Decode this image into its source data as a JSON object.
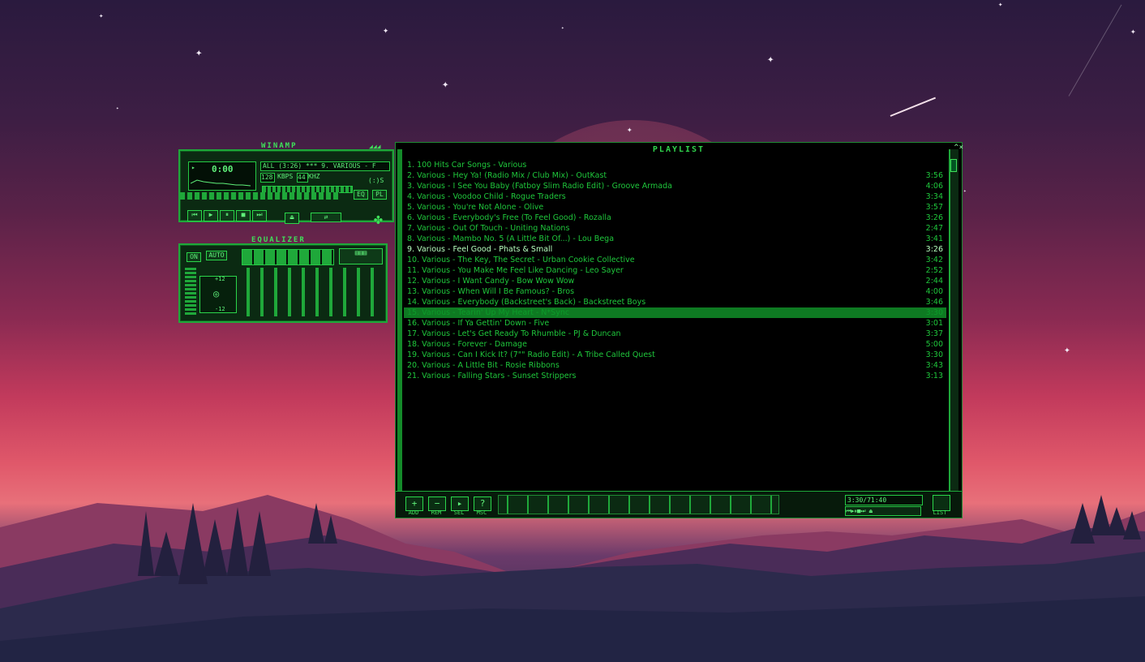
{
  "main_window": {
    "title": "WINAMP",
    "song_ticker": "ALL (3:26) *** 9. VARIOUS - F",
    "time": "0:00",
    "bitrate": "128",
    "kbps_label": "KBPS",
    "khz": "44",
    "khz_label": "KHZ",
    "stereo_label": "(:)S",
    "eq_label": "EQ",
    "pl_label": "PL"
  },
  "equalizer": {
    "title": "EQUALIZER",
    "on_label": "ON",
    "auto_label": "AUTO",
    "plus_label": "+12",
    "minus_label": "-12"
  },
  "playlist": {
    "title": "PLAYLIST",
    "buttons": [
      {
        "icon": "+",
        "label": "ADD"
      },
      {
        "icon": "−",
        "label": "REM"
      },
      {
        "icon": "▸",
        "label": "SEL"
      },
      {
        "icon": "?",
        "label": "MSC"
      }
    ],
    "list_label": "LIST",
    "time_display": "3:30/71:40",
    "tracks": [
      {
        "num": "1.",
        "title": "100 Hits Car Songs - Various",
        "duration": ""
      },
      {
        "num": "2.",
        "title": "Various - Hey Ya! (Radio Mix / Club Mix) - OutKast",
        "duration": "3:56"
      },
      {
        "num": "3.",
        "title": "Various - I See You Baby (Fatboy Slim Radio Edit) - Groove Armada",
        "duration": "4:06"
      },
      {
        "num": "4.",
        "title": "Various - Voodoo Child - Rogue Traders",
        "duration": "3:34"
      },
      {
        "num": "5.",
        "title": "Various - You're Not Alone - Olive",
        "duration": "3:57"
      },
      {
        "num": "6.",
        "title": "Various - Everybody's Free (To Feel Good) - Rozalla",
        "duration": "3:26"
      },
      {
        "num": "7.",
        "title": "Various - Out Of Touch - Uniting Nations",
        "duration": "2:47"
      },
      {
        "num": "8.",
        "title": "Various - Mambo No. 5 (A Little Bit Of...) - Lou Bega",
        "duration": "3:41"
      },
      {
        "num": "9.",
        "title": "Various - Feel Good - Phats & Small",
        "duration": "3:26"
      },
      {
        "num": "10.",
        "title": "Various - The Key, The Secret - Urban Cookie Collective",
        "duration": "3:42"
      },
      {
        "num": "11.",
        "title": "Various - You Make Me Feel Like Dancing - Leo Sayer",
        "duration": "2:52"
      },
      {
        "num": "12.",
        "title": "Various - I Want Candy - Bow Wow Wow",
        "duration": "2:44"
      },
      {
        "num": "13.",
        "title": "Various - When Will I Be Famous? - Bros",
        "duration": "4:00"
      },
      {
        "num": "14.",
        "title": "Various - Everybody (Backstreet's Back) - Backstreet Boys",
        "duration": "3:46"
      },
      {
        "num": "15.",
        "title": "Various - Tearin' Up My Heart - N*Sync",
        "duration": "3:30"
      },
      {
        "num": "16.",
        "title": "Various - If Ya Gettin' Down - Five",
        "duration": "3:01"
      },
      {
        "num": "17.",
        "title": "Various - Let's Get Ready To Rhumble - PJ & Duncan",
        "duration": "3:37"
      },
      {
        "num": "18.",
        "title": "Various - Forever - Damage",
        "duration": "5:00"
      },
      {
        "num": "19.",
        "title": "Various - Can I Kick It? (7\"\" Radio Edit) - A Tribe Called Quest",
        "duration": "3:30"
      },
      {
        "num": "20.",
        "title": "Various - A Little Bit - Rosie Ribbons",
        "duration": "3:43"
      },
      {
        "num": "21.",
        "title": "Various - Falling Stars - Sunset Strippers",
        "duration": "3:13"
      }
    ],
    "current_index": 8,
    "selected_index": 14
  },
  "icons": [
    "close-icon",
    "shade-icon",
    "add-icon",
    "remove-icon",
    "select-icon",
    "misc-icon",
    "list-icon"
  ]
}
